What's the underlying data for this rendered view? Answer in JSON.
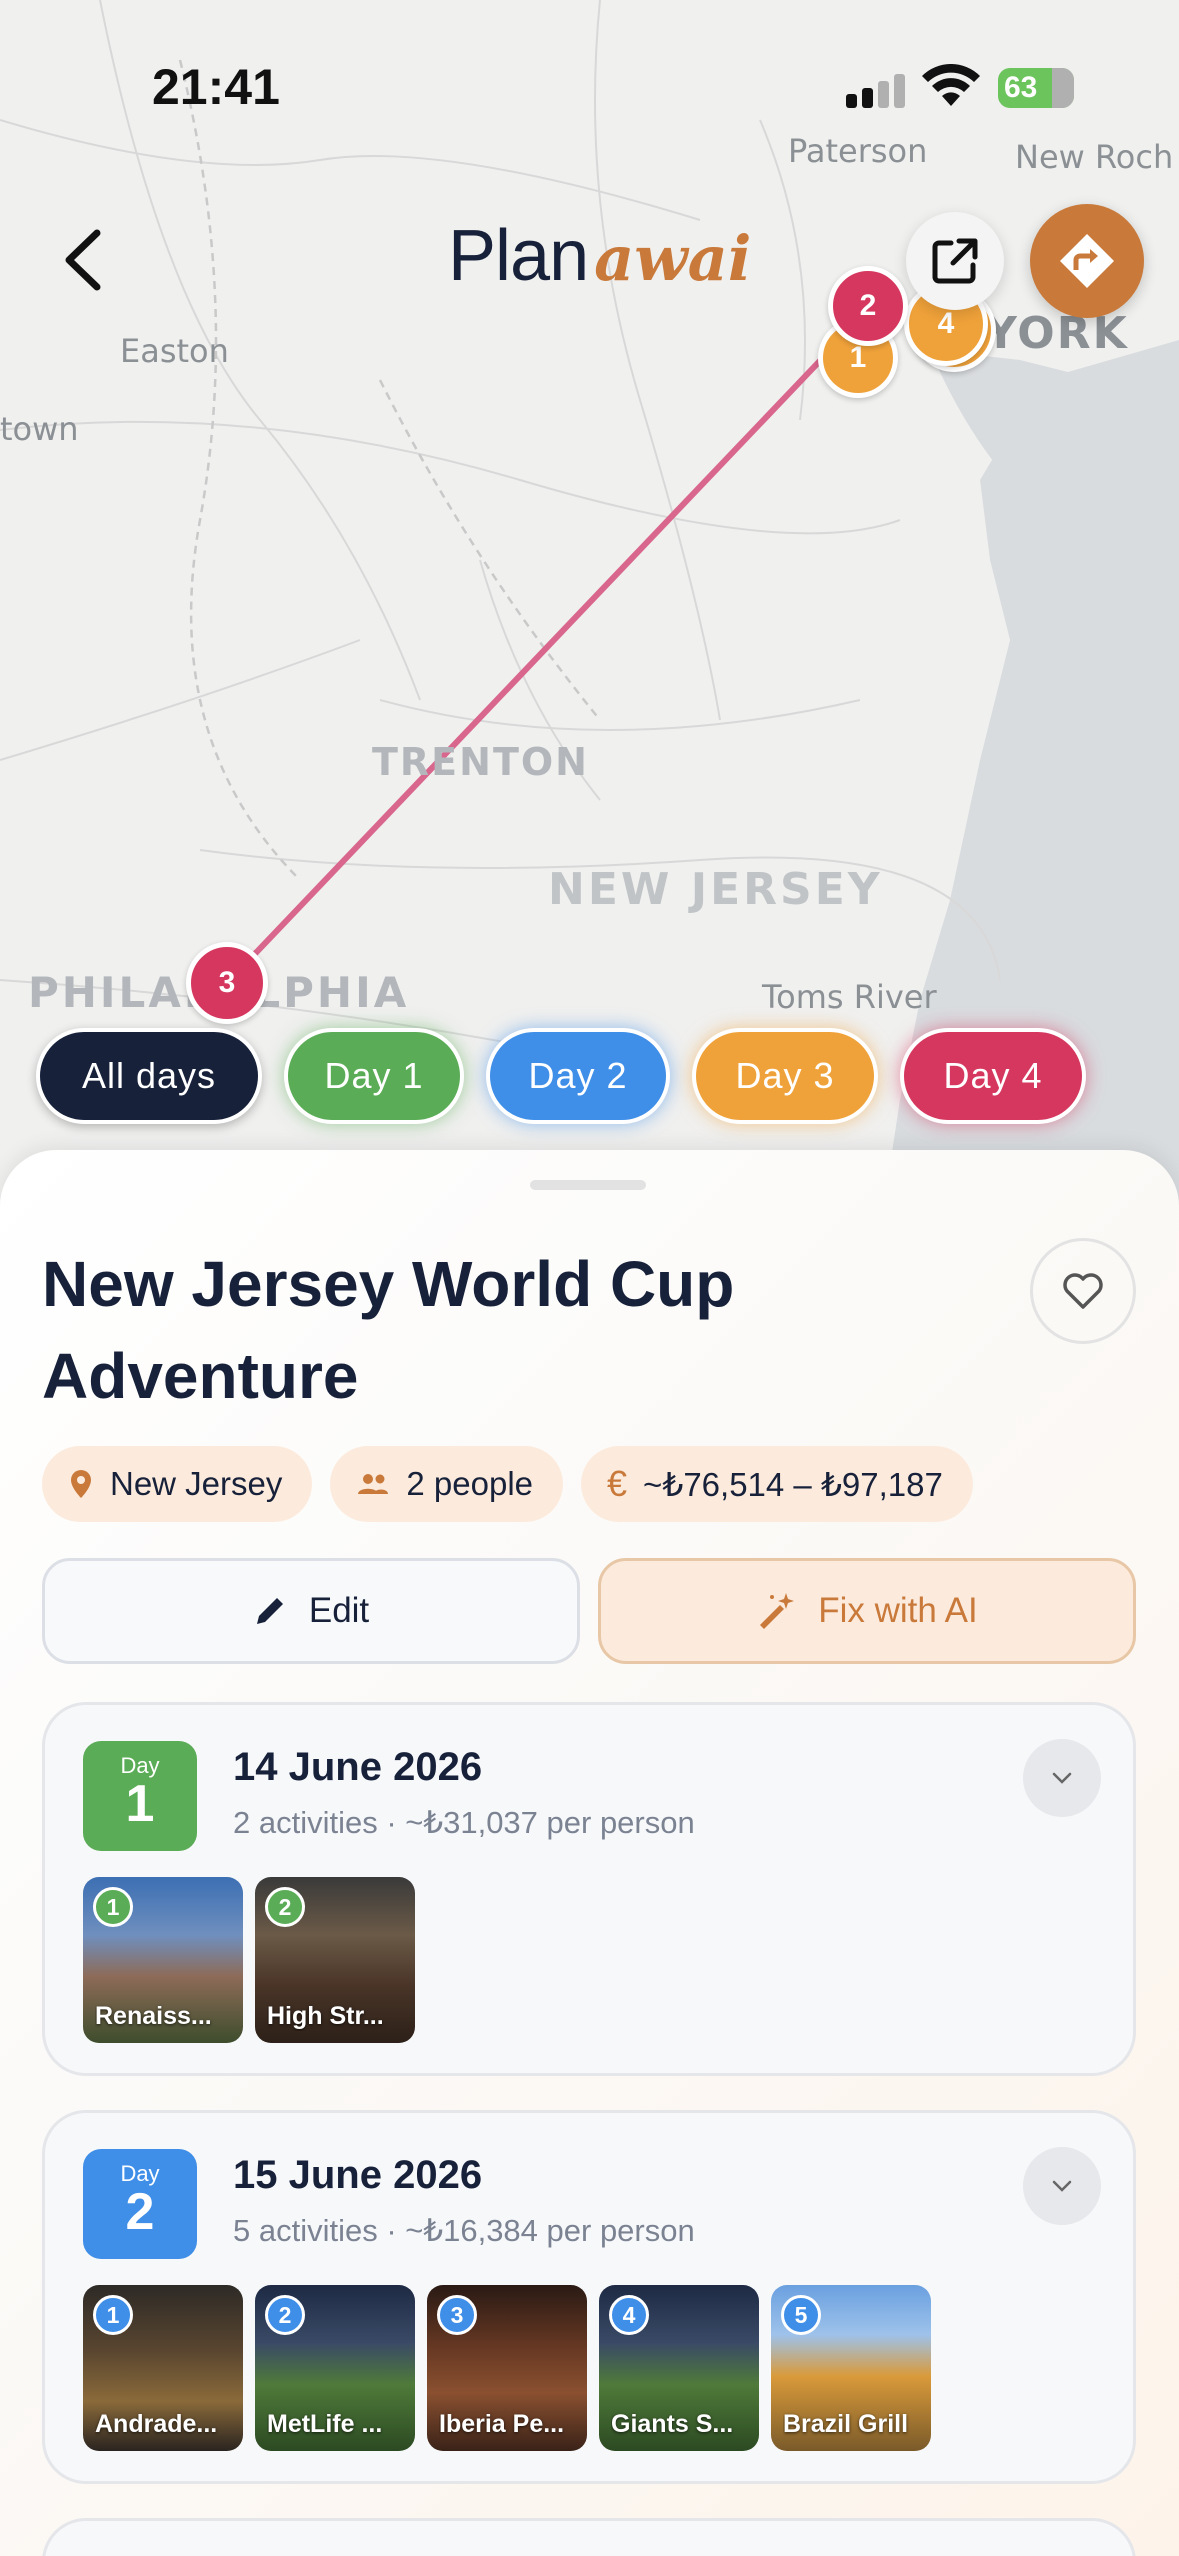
{
  "status_bar": {
    "time": "21:41",
    "battery": "63"
  },
  "header": {
    "logo_main": "Plan",
    "logo_accent": "awai"
  },
  "map": {
    "labels": {
      "paterson": "Paterson",
      "new_roch": "New Roch",
      "easton": "Easton",
      "town": "town",
      "york": "YORK",
      "trenton": "TRENTON",
      "new_jersey": "NEW JERSEY",
      "philadelphia": "PHILADELPHIA",
      "toms_river": "Toms River"
    },
    "markers": [
      {
        "label": "2",
        "color": "#d6375f"
      },
      {
        "label": "1",
        "color": "#f0a23a"
      },
      {
        "label": "4",
        "color": "#f0a23a"
      },
      {
        "label": "3",
        "color": "#d6375f"
      }
    ],
    "route_color": "#d9668c"
  },
  "day_filters": [
    {
      "label": "All days",
      "color": "#17213a",
      "selected": true
    },
    {
      "label": "Day 1",
      "color": "#5aac56"
    },
    {
      "label": "Day 2",
      "color": "#3f8ee8"
    },
    {
      "label": "Day 3",
      "color": "#f0a23a"
    },
    {
      "label": "Day 4",
      "color": "#d6375f"
    }
  ],
  "trip": {
    "title": "New Jersey World Cup Adventure",
    "location": "New Jersey",
    "people": "2 people",
    "budget": "~₺76,514 – ₺97,187",
    "edit_label": "Edit",
    "fix_ai_label": "Fix with AI"
  },
  "days": [
    {
      "day_label": "Day",
      "day_number": "1",
      "color": "#5aac56",
      "date": "14 June 2026",
      "meta": "2 activities · ~₺31,037 per person",
      "activities": [
        {
          "num": "1",
          "name": "Renaiss..."
        },
        {
          "num": "2",
          "name": "High Str..."
        }
      ]
    },
    {
      "day_label": "Day",
      "day_number": "2",
      "color": "#3f8ee8",
      "date": "15 June 2026",
      "meta": "5 activities · ~₺16,384 per person",
      "activities": [
        {
          "num": "1",
          "name": "Andrade..."
        },
        {
          "num": "2",
          "name": "MetLife ..."
        },
        {
          "num": "3",
          "name": "Iberia Pe..."
        },
        {
          "num": "4",
          "name": "Giants S..."
        },
        {
          "num": "5",
          "name": "Brazil Grill"
        }
      ]
    }
  ],
  "colors": {
    "brand": "#c97a3b",
    "navy": "#17213a"
  }
}
